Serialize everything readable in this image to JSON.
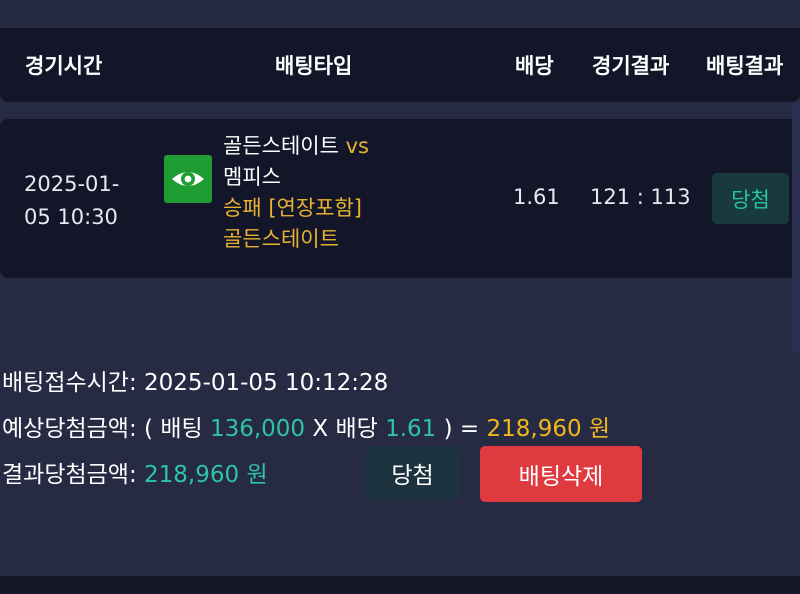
{
  "header": {
    "time": "경기시간",
    "type": "배팅타입",
    "odds": "배당",
    "game_result": "경기결과",
    "bet_result": "배팅결과"
  },
  "bet_row": {
    "time_line1": "2025-01-",
    "time_line2": "05 10:30",
    "icon": "eye-icon",
    "home_team": "골든스테이트",
    "vs": "vs",
    "away_team": "멤피스",
    "market": "승패 [연장포함]",
    "pick": "골든스테이트",
    "odds": "1.61",
    "score": "121 : 113",
    "result_badge": "당첨"
  },
  "summary": {
    "received_label": "배팅접수시간: ",
    "received_value": "2025-01-05 10:12:28",
    "expected_label": "예상당첨금액: ",
    "expected_open": "( 배팅 ",
    "stake": "136,000",
    "times": " X 배당 ",
    "odds": "1.61",
    "close": " ) = ",
    "expected_amount": "218,960 원",
    "result_label": "결과당첨금액: ",
    "result_amount": "218,960 원"
  },
  "buttons": {
    "win": "당첨",
    "delete": "배팅삭제"
  },
  "colors": {
    "background": "#262a43",
    "panel": "#131629",
    "accent_green": "#2ec4a4",
    "accent_yellow": "#f2b71e",
    "danger": "#de3a3f",
    "icon_green": "#1f9d32"
  }
}
